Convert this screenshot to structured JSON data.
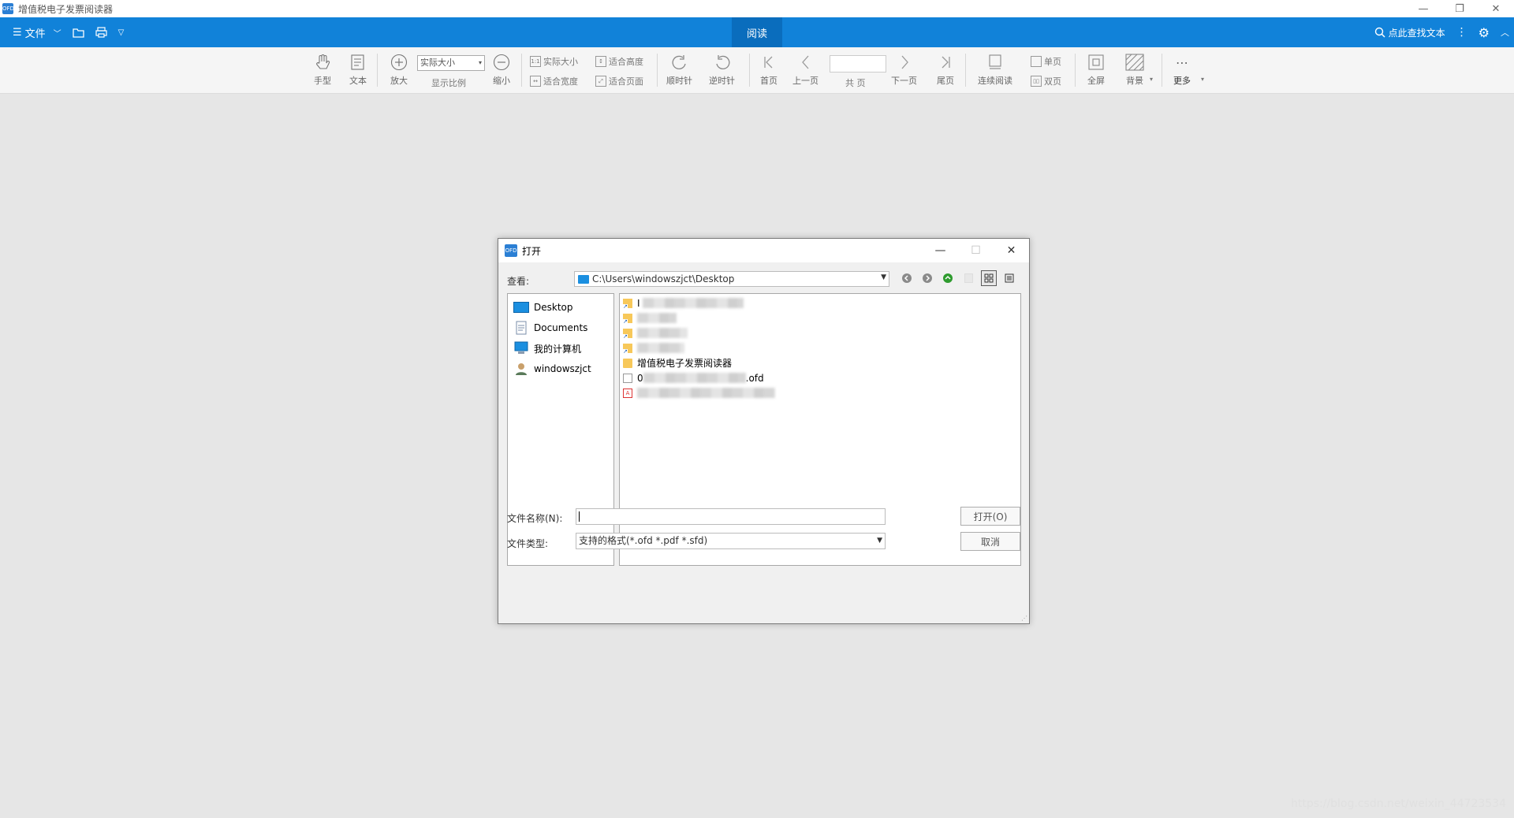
{
  "app": {
    "title": "增值税电子发票阅读器",
    "logo_text": "OFD"
  },
  "window_controls": {
    "minimize": "—",
    "restore": "❐",
    "close": "✕"
  },
  "ribbon": {
    "file_label": "文件",
    "active_tab": "阅读",
    "search_label": "点此查找文本"
  },
  "toolbar": {
    "hand": "手型",
    "text": "文本",
    "zoom_in": "放大",
    "zoom_value": "实际大小",
    "zoom_ratio": "显示比例",
    "zoom_out": "缩小",
    "actual_size": "实际大小",
    "fit_height": "适合高度",
    "fit_width": "适合宽度",
    "fit_page": "适合页面",
    "clockwise": "顺时针",
    "counterclockwise": "逆时针",
    "first_page": "首页",
    "prev_page": "上一页",
    "total_pages": "共 页",
    "next_page": "下一页",
    "last_page": "尾页",
    "continuous": "连续阅读",
    "single_page": "单页",
    "double_page": "双页",
    "fullscreen": "全屏",
    "background": "背景",
    "more": "更多"
  },
  "dialog": {
    "title": "打开",
    "logo_text": "OFD",
    "look_in_label": "查看:",
    "look_in_path": "C:\\Users\\windowszjct\\Desktop",
    "sidebar": [
      {
        "label": "Desktop"
      },
      {
        "label": "Documents"
      },
      {
        "label": "我的计算机"
      },
      {
        "label": "windowszjct"
      }
    ],
    "files": [
      {
        "type": "shortcut",
        "prefix": "I",
        "name": ""
      },
      {
        "type": "shortcut",
        "prefix": "",
        "name": ""
      },
      {
        "type": "shortcut",
        "prefix": "",
        "name": ""
      },
      {
        "type": "shortcut",
        "prefix": "",
        "name": ""
      },
      {
        "type": "folder",
        "prefix": "",
        "name": "增值税电子发票阅读器"
      },
      {
        "type": "file",
        "prefix": "0",
        "name": ".ofd"
      },
      {
        "type": "pdf",
        "prefix": "",
        "name": ""
      }
    ],
    "filename_label": "文件名称(N):",
    "filename_value": "",
    "filetype_label": "文件类型:",
    "filetype_value": "支持的格式(*.ofd *.pdf *.sfd)",
    "open_button": "打开(O)",
    "cancel_button": "取消"
  },
  "watermark": "https://blog.csdn.net/weixin_44723534"
}
